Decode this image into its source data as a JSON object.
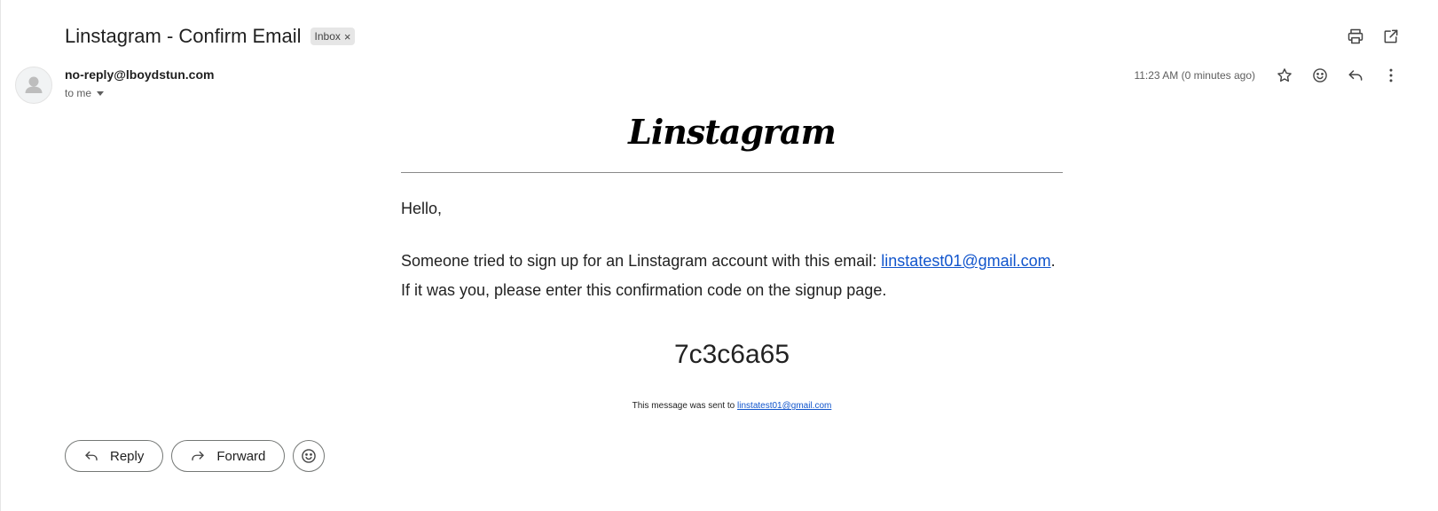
{
  "email": {
    "subject": "Linstagram - Confirm Email",
    "label_chip": "Inbox",
    "label_chip_remove": "×",
    "sender": "no-reply@lboydstun.com",
    "recipient_line": "to me",
    "timestamp": "11:23 AM (0 minutes ago)"
  },
  "body": {
    "brand": "Linstagram",
    "greeting": "Hello,",
    "line1_prefix": "Someone tried to sign up for an Linstagram account with this email: ",
    "line1_email": "linstatest01@gmail.com",
    "line1_suffix": ".",
    "line2": "If it was you, please enter this confirmation code on the signup page.",
    "code": "7c3c6a65",
    "footer_prefix": "This message was sent to ",
    "footer_email": "linstatest01@gmail.com"
  },
  "actions": {
    "reply_label": "Reply",
    "forward_label": "Forward"
  },
  "icons": {
    "top": [
      "print-icon",
      "open-in-new-window-icon"
    ],
    "meta": [
      "star-icon",
      "emoji-icon",
      "reply-icon",
      "more-vert-icon"
    ],
    "bottom": [
      "reply-icon",
      "forward-icon",
      "emoji-icon"
    ]
  },
  "colors": {
    "link": "#1155cc",
    "text": "#1f1f1f",
    "chip_bg": "#e6e6e6"
  }
}
